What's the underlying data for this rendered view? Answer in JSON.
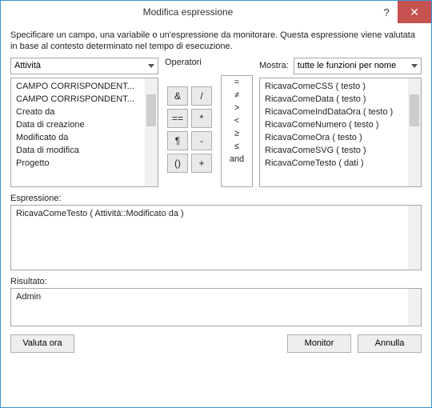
{
  "title": "Modifica espressione",
  "description": "Specificare un campo, una variabile o un'espressione da monitorare. Questa espressione viene valutata in base al contesto determinato nel tempo di esecuzione.",
  "fields_combo": "Attività",
  "fields_list": [
    "CAMPO CORRISPONDENT...",
    "CAMPO CORRISPONDENT...",
    "Creato da",
    "Data di creazione",
    "Modificato da",
    "Data di modifica",
    "Progetto"
  ],
  "operators_label": "Operatori",
  "op_buttons": [
    "&",
    "/",
    "==",
    "*",
    "¶",
    "-",
    "()",
    "+"
  ],
  "sym_list": [
    "=",
    "≠",
    ">",
    "<",
    "≥",
    "≤",
    "and"
  ],
  "show_label": "Mostra:",
  "show_combo": "tutte le funzioni per nome",
  "func_list": [
    "RicavaComeCSS ( testo )",
    "RicavaComeData ( testo )",
    "RicavaComeIndDataOra ( testo )",
    "RicavaComeNumero ( testo )",
    "RicavaComeOra ( testo )",
    "RicavaComeSVG ( testo )",
    "RicavaComeTesto ( dati )"
  ],
  "expr_label": "Espressione:",
  "expr_value": "RicavaComeTesto ( Attività::Modificato da )",
  "result_label": "Risultato:",
  "result_value": "Admin",
  "btn_eval": "Valuta ora",
  "btn_monitor": "Monitor",
  "btn_cancel": "Annulla"
}
